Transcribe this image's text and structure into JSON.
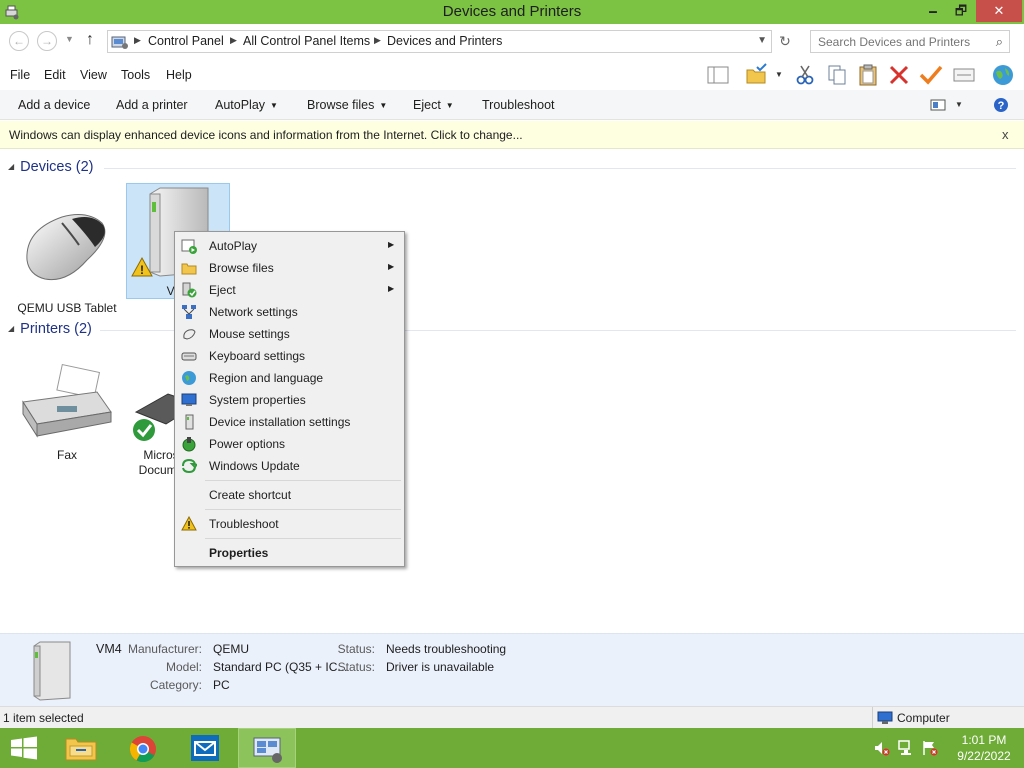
{
  "window": {
    "title": "Devices and Printers",
    "minimize": "🗕",
    "maximize": "🗗",
    "close": "✕"
  },
  "address": {
    "crumbs": [
      "Control Panel",
      "All Control Panel Items",
      "Devices and Printers"
    ],
    "search_placeholder": "Search Devices and Printers"
  },
  "menubar": {
    "items": [
      "File",
      "Edit",
      "View",
      "Tools",
      "Help"
    ]
  },
  "commandbar": {
    "add_device": "Add a device",
    "add_printer": "Add a printer",
    "autoplay": "AutoPlay",
    "browse_files": "Browse files",
    "eject": "Eject",
    "troubleshoot": "Troubleshoot"
  },
  "infobar": {
    "message": "Windows can display enhanced device icons and information from the Internet. Click to change...",
    "close": "x"
  },
  "groups": {
    "devices": {
      "title": "Devices (2)",
      "items": [
        "QEMU USB Tablet",
        "VM4"
      ]
    },
    "printers": {
      "title": "Printers (2)",
      "items": [
        "Fax",
        "Micros Docume"
      ]
    }
  },
  "context_menu": {
    "items": [
      {
        "label": "AutoPlay",
        "submenu": true
      },
      {
        "label": "Browse files",
        "submenu": true
      },
      {
        "label": "Eject",
        "submenu": true
      },
      {
        "label": "Network settings"
      },
      {
        "label": "Mouse settings"
      },
      {
        "label": "Keyboard settings"
      },
      {
        "label": "Region and language"
      },
      {
        "label": "System properties"
      },
      {
        "label": "Device installation settings"
      },
      {
        "label": "Power options"
      },
      {
        "label": "Windows Update"
      },
      {
        "label": "Create shortcut"
      },
      {
        "label": "Troubleshoot"
      },
      {
        "label": "Properties"
      }
    ]
  },
  "details": {
    "name": "VM4",
    "manufacturer_label": "Manufacturer:",
    "manufacturer": "QEMU",
    "model_label": "Model:",
    "model": "Standard PC (Q35 + IC...",
    "category_label": "Category:",
    "category": "PC",
    "status1_label": "Status:",
    "status1": "Needs troubleshooting",
    "status2_label": "Status:",
    "status2": "Driver is unavailable"
  },
  "statusbar": {
    "selection": "1 item selected",
    "location": "Computer"
  },
  "taskbar": {
    "time": "1:01 PM",
    "date": "9/22/2022"
  },
  "colors": {
    "titlebar": "#7cc243",
    "taskbar": "#6fac37",
    "infobar": "#fefee1",
    "details": "#eaf1fb",
    "group_heading": "#1e3287",
    "selection": "#cce4f7"
  }
}
